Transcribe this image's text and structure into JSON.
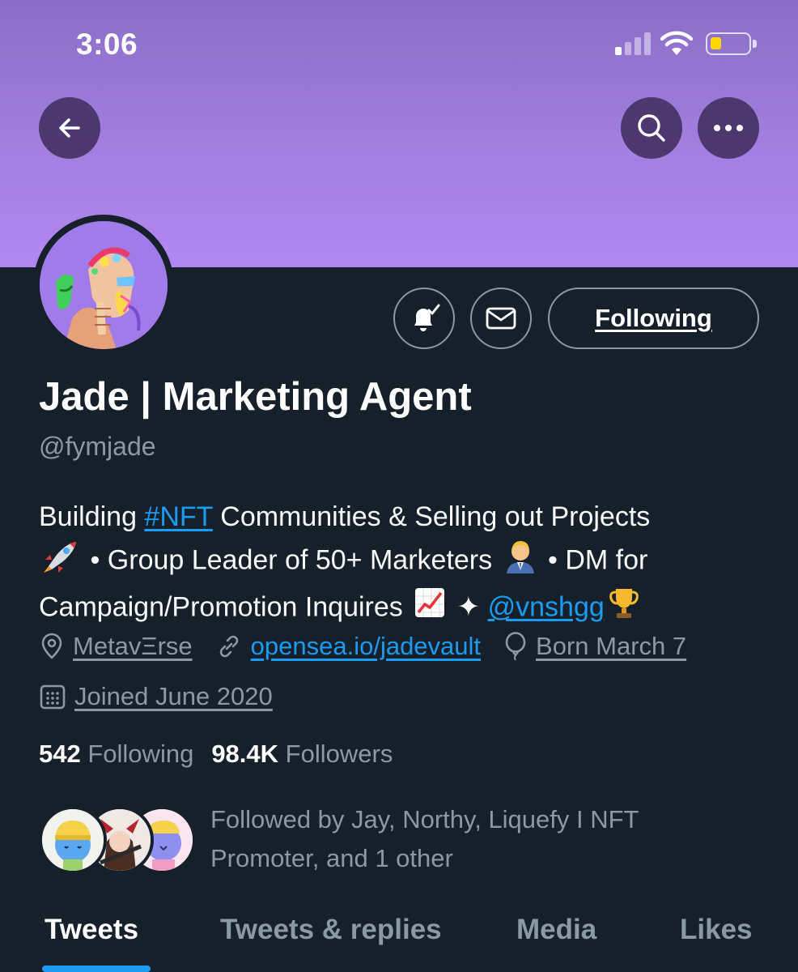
{
  "status_bar": {
    "time": "3:06",
    "signal_bars_on": 1,
    "signal_bars_total": 4,
    "battery_level": 0.2,
    "battery_color": "#ffd60a"
  },
  "header": {
    "back_icon": "arrow-left-icon",
    "search_icon": "search-icon",
    "more_icon": "more-horizontal-icon",
    "banner_color": "#a27fe0"
  },
  "profile_actions": {
    "notify_icon": "bell-check-icon",
    "message_icon": "mail-icon",
    "follow_label": "Following"
  },
  "profile": {
    "display_name": "Jade | Marketing Agent",
    "handle": "@fymjade",
    "bio": {
      "part1": "Building ",
      "hashtag": "#NFT",
      "part2": " Communities & Selling out Projects",
      "part3": " • Group Leader of 50+ Marketers ",
      "part4": " • DM for Campaign/Promotion Inquires ",
      "part5": " ✦ ",
      "mention": "@vnshgg"
    },
    "location": "MetavΞrse",
    "website": "opensea.io/jadevault",
    "birthday": "Born March 7",
    "joined": "Joined June 2020"
  },
  "stats": {
    "following_count": "542",
    "following_label": "Following",
    "followers_count": "98.4K",
    "followers_label": "Followers"
  },
  "followed_by": {
    "text": "Followed by Jay, Northy, Liquefy I NFT Promoter, and 1 other"
  },
  "tabs": [
    {
      "label": "Tweets",
      "active": true
    },
    {
      "label": "Tweets & replies",
      "active": false
    },
    {
      "label": "Media",
      "active": false
    },
    {
      "label": "Likes",
      "active": false
    }
  ],
  "colors": {
    "background": "#15202b",
    "accent": "#1d9bf0",
    "muted_text": "#8b98a5"
  }
}
